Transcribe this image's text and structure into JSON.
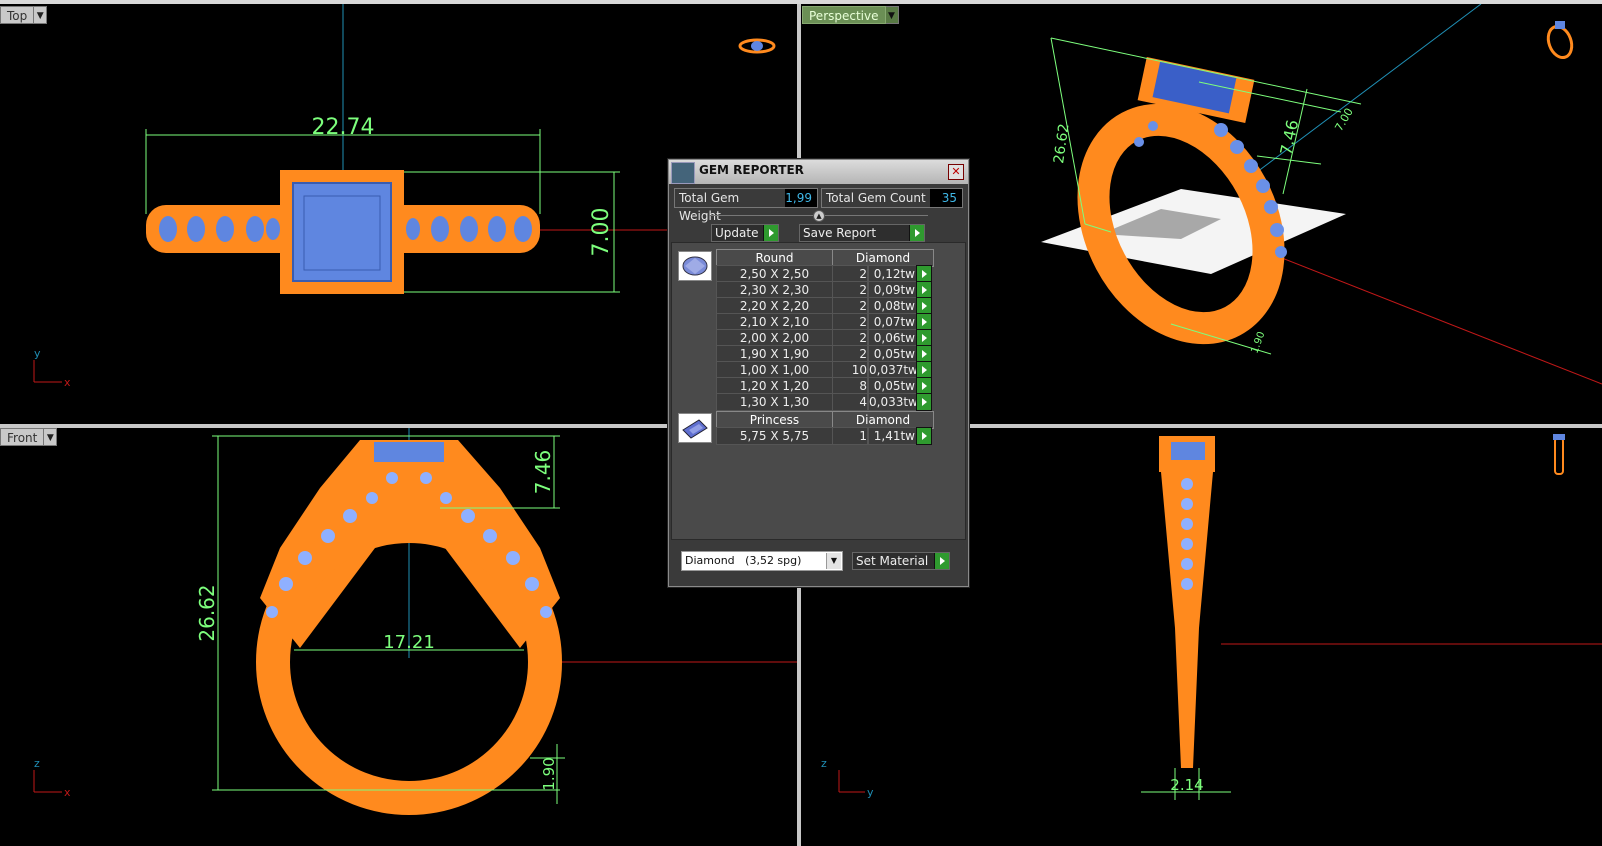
{
  "viewports": {
    "top": {
      "label": "Top",
      "dims": [
        "22.74",
        "7.00"
      ],
      "axes": [
        "y",
        "x"
      ]
    },
    "perspective": {
      "label": "Perspective",
      "dims": [
        "26.62",
        "7.46",
        "7.00",
        "1.90"
      ]
    },
    "front": {
      "label": "Front",
      "dims": [
        "7.46",
        "26.62",
        "17.21",
        "1.90"
      ],
      "axes": [
        "z",
        "x"
      ]
    },
    "right": {
      "dims": [
        "2.14"
      ],
      "axes": [
        "z",
        "y"
      ]
    }
  },
  "gem_reporter": {
    "title": "GEM REPORTER",
    "total_weight_label": "Total Gem Weight",
    "total_weight": "1,99",
    "total_count_label": "Total Gem Count",
    "total_count": "35",
    "update_label": "Update",
    "save_label": "Save Report",
    "groups": [
      {
        "shape": "Round",
        "material": "Diamond",
        "rows": [
          {
            "size": "2,50 X 2,50",
            "count": "2",
            "weight": "0,12tw"
          },
          {
            "size": "2,30 X 2,30",
            "count": "2",
            "weight": "0,09tw"
          },
          {
            "size": "2,20 X 2,20",
            "count": "2",
            "weight": "0,08tw"
          },
          {
            "size": "2,10 X 2,10",
            "count": "2",
            "weight": "0,07tw"
          },
          {
            "size": "2,00 X 2,00",
            "count": "2",
            "weight": "0,06tw"
          },
          {
            "size": "1,90 X 1,90",
            "count": "2",
            "weight": "0,05tw"
          },
          {
            "size": "1,00 X 1,00",
            "count": "10",
            "weight": "0,037tw"
          },
          {
            "size": "1,20 X 1,20",
            "count": "8",
            "weight": "0,05tw"
          },
          {
            "size": "1,30 X 1,30",
            "count": "4",
            "weight": "0,033tw"
          }
        ]
      },
      {
        "shape": "Princess",
        "material": "Diamond",
        "rows": [
          {
            "size": "5,75 X 5,75",
            "count": "1",
            "weight": "1,41tw"
          }
        ]
      }
    ],
    "material_select": "Diamond   (3,52 spg)",
    "set_material_label": "Set Material"
  },
  "colors": {
    "metal": "#ff8a1e",
    "gem": "#5f86e0",
    "dimension": "#7dff7d",
    "axis_x": "#c01818",
    "axis_y": "#1f8fb5"
  }
}
